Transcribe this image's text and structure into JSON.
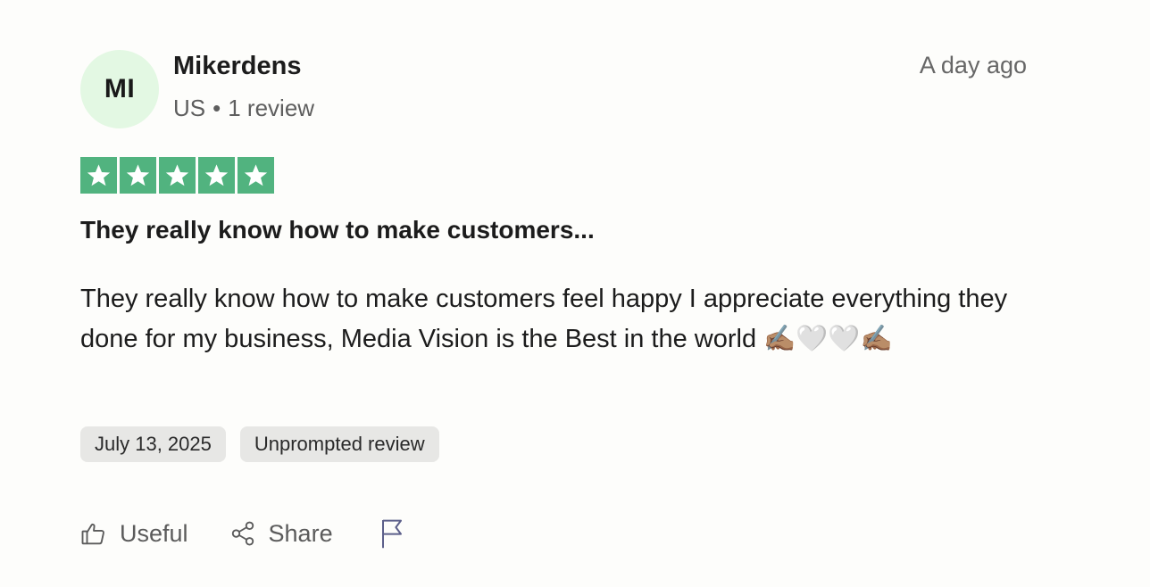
{
  "review": {
    "avatar_initials": "MI",
    "reviewer_name": "Mikerdens",
    "country": "US",
    "separator": "•",
    "review_count": "1 review",
    "posted_relative": "A day ago",
    "rating": 5,
    "rating_max": 5,
    "title": "They really know how to make customers...",
    "text": "They really know how to make customers feel happy I appreciate everything they done for my business, Media Vision is the Best in the world ✍🏽🤍🤍✍🏽",
    "date_tag": "July 13, 2025",
    "source_tag": "Unprompted review"
  },
  "actions": {
    "useful_label": "Useful",
    "share_label": "Share"
  },
  "colors": {
    "star_green": "#51b37f",
    "avatar_bg": "#e3f8e3",
    "tag_bg": "#e7e7e5"
  },
  "icons": {
    "useful": "thumbs-up-icon",
    "share": "share-icon",
    "report": "flag-icon",
    "star": "star-icon"
  }
}
